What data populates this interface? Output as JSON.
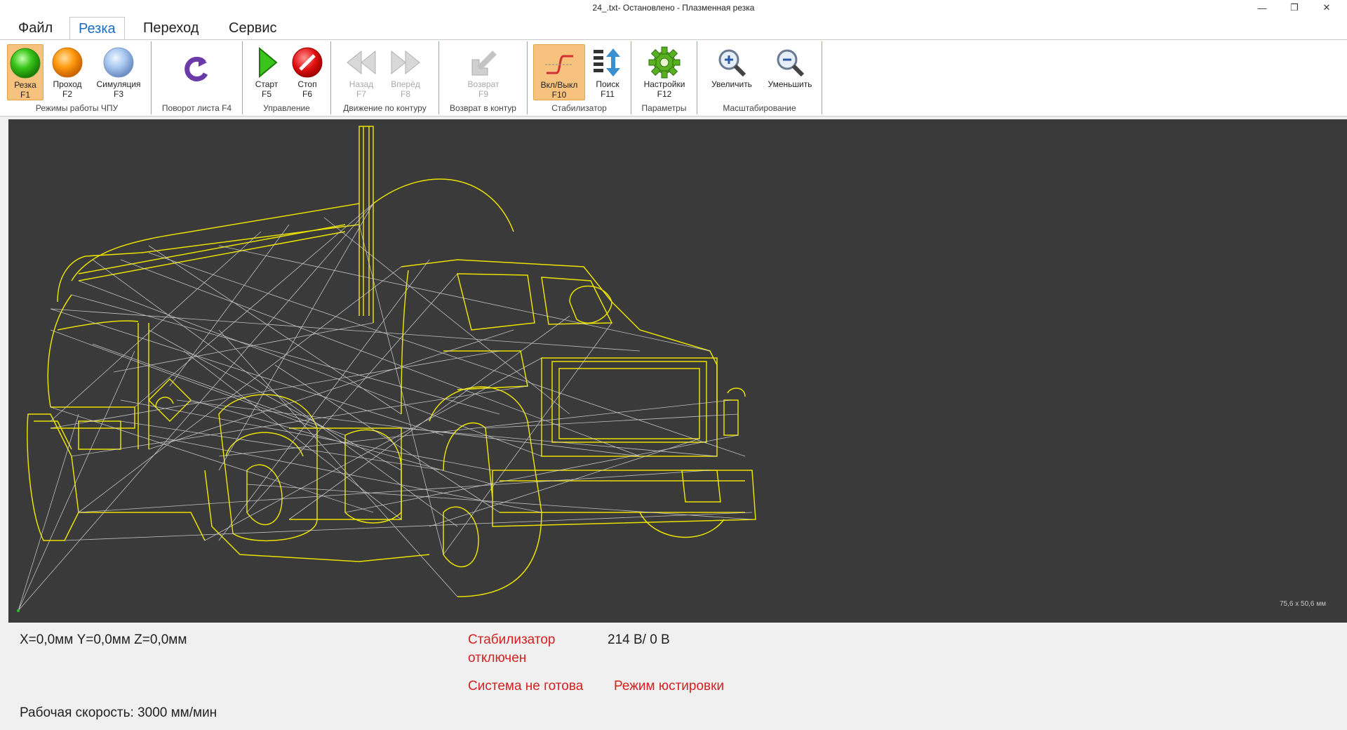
{
  "window": {
    "title": "24_.txt- Остановлено - Плазменная резка",
    "minimize_glyph": "—",
    "restore_glyph": "❐",
    "close_glyph": "✕"
  },
  "tabs": [
    "Файл",
    "Резка",
    "Переход",
    "Сервис"
  ],
  "active_tab": "Резка",
  "ribbon": {
    "groups": {
      "modes": "Режимы работы ЧПУ",
      "rotate": "Поворот листа F4",
      "control": "Управление",
      "contour": "Движение по контуру",
      "return": "Возврат в контур",
      "stabilizer": "Стабилизатор",
      "params": "Параметры",
      "scale": "Масштабирование"
    },
    "buttons": {
      "cut": {
        "l1": "Резка",
        "l2": "F1"
      },
      "pass": {
        "l1": "Проход",
        "l2": "F2"
      },
      "sim": {
        "l1": "Симуляция",
        "l2": "F3"
      },
      "start": {
        "l1": "Старт",
        "l2": "F5"
      },
      "stop": {
        "l1": "Стоп",
        "l2": "F6"
      },
      "back": {
        "l1": "Назад",
        "l2": "F7"
      },
      "fwd": {
        "l1": "Вперёд",
        "l2": "F8"
      },
      "ret": {
        "l1": "Возврат",
        "l2": "F9"
      },
      "stab": {
        "l1": "Вкл/Выкл",
        "l2": "F10"
      },
      "search": {
        "l1": "Поиск",
        "l2": "F11"
      },
      "settings": {
        "l1": "Настройки",
        "l2": "F12"
      },
      "zoomin": {
        "l1": "Увеличить"
      },
      "zoomout": {
        "l1": "Уменьшить"
      }
    },
    "icons": {
      "cut": "green-circle-icon",
      "pass": "orange-circle-icon",
      "sim": "blue-circle-icon",
      "rotate": "rotate-sheet-icon",
      "start": "play-icon",
      "stop": "stop-icon",
      "back": "rewind-icon",
      "fwd": "fast-forward-icon",
      "ret": "return-arrow-icon",
      "stab": "stabilizer-icon",
      "search": "search-list-icon",
      "settings": "gear-icon",
      "zoomin": "zoom-in-icon",
      "zoomout": "zoom-out-icon"
    }
  },
  "canvas": {
    "dimensions": "75,6 x 50,6 мм",
    "background": "#3a3a3a",
    "contour_color": "#e8e000",
    "path_color": "#e0e0e0"
  },
  "status": {
    "coords": "X=0,0мм  Y=0,0мм  Z=0,0мм",
    "stabilizer_line1": "Стабилизатор",
    "stabilizer_line2": "отключен",
    "voltage": "214 В/ 0 В",
    "not_ready": "Система не готова",
    "mode": "Режим юстировки",
    "speed": "Рабочая скорость: 3000 мм/мин"
  },
  "colors": {
    "accent": "#1b6dc1",
    "active_button": "#f6c27d",
    "alert": "#d62020"
  }
}
